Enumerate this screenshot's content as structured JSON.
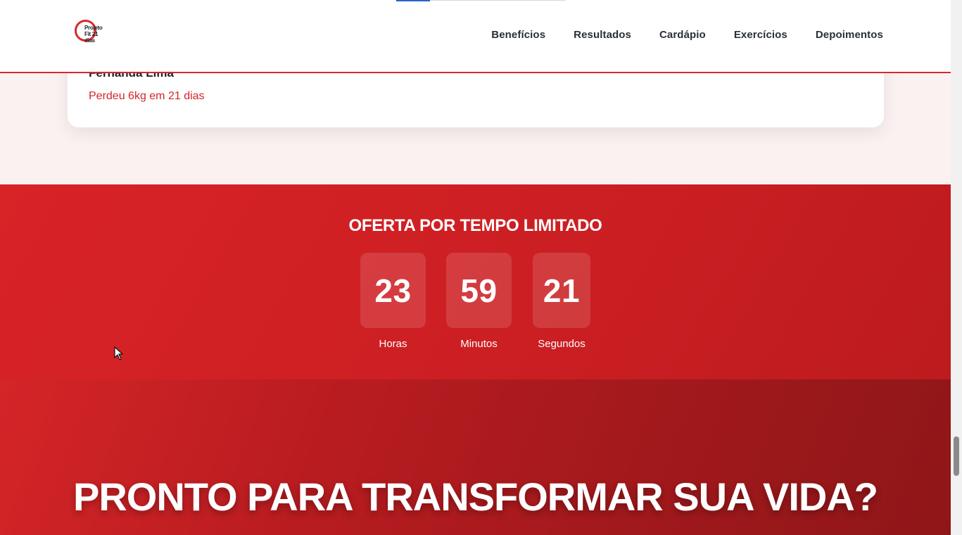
{
  "header": {
    "logo": {
      "line1": "Projeto",
      "line2": "Fit 21 dias"
    },
    "nav": [
      {
        "label": "Benefícios"
      },
      {
        "label": "Resultados"
      },
      {
        "label": "Cardápio"
      },
      {
        "label": "Exercícios"
      },
      {
        "label": "Depoimentos"
      }
    ]
  },
  "testimonial": {
    "name": "Fernanda Lima",
    "result": "Perdeu 6kg em 21 dias"
  },
  "offer": {
    "title": "OFERTA POR TEMPO LIMITADO",
    "countdown": [
      {
        "value": "23",
        "label": "Horas"
      },
      {
        "value": "59",
        "label": "Minutos"
      },
      {
        "value": "21",
        "label": "Segundos"
      }
    ]
  },
  "cta": {
    "title": "PRONTO PARA TRANSFORMAR SUA VIDA?"
  },
  "colors": {
    "brand_red": "#d9282c",
    "offer_bg": "#cc1f23",
    "cta_bg_dark": "#8f1618",
    "text_dark": "#2a2f38"
  }
}
